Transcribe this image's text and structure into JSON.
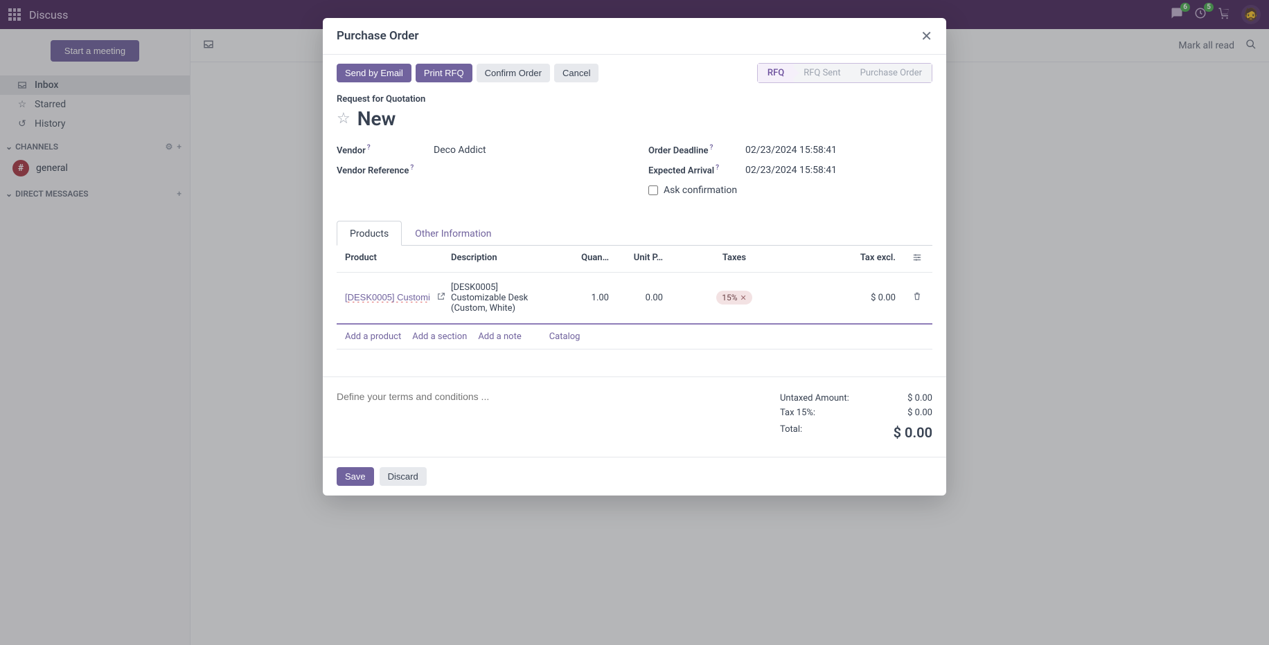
{
  "navbar": {
    "title": "Discuss",
    "chat_badge": "6",
    "activity_badge": "5"
  },
  "sidebar": {
    "start_meeting": "Start a meeting",
    "nav": {
      "inbox": "Inbox",
      "starred": "Starred",
      "history": "History"
    },
    "channels_header": "CHANNELS",
    "channel_general": "general",
    "dm_header": "DIRECT MESSAGES"
  },
  "content_header": {
    "mark_all_read": "Mark all read"
  },
  "modal": {
    "title": "Purchase Order",
    "actions": {
      "send_email": "Send by Email",
      "print_rfq": "Print RFQ",
      "confirm": "Confirm Order",
      "cancel": "Cancel"
    },
    "status": {
      "rfq": "RFQ",
      "rfq_sent": "RFQ Sent",
      "purchase_order": "Purchase Order"
    },
    "rfq_label": "Request for Quotation",
    "rfq_title": "New",
    "form": {
      "vendor_label": "Vendor",
      "vendor_value": "Deco Addict",
      "vendor_ref_label": "Vendor Reference",
      "vendor_ref_value": "",
      "deadline_label": "Order Deadline",
      "deadline_value": "02/23/2024 15:58:41",
      "arrival_label": "Expected Arrival",
      "arrival_value": "02/23/2024 15:58:41",
      "ask_confirmation": "Ask confirmation"
    },
    "tabs": {
      "products": "Products",
      "other": "Other Information"
    },
    "table": {
      "headers": {
        "product": "Product",
        "description": "Description",
        "quantity": "Quan…",
        "unit_price": "Unit P…",
        "taxes": "Taxes",
        "tax_excl": "Tax excl."
      },
      "row": {
        "product": "[DESK0005] Customi",
        "description": "[DESK0005] Customizable Desk (Custom, White)",
        "quantity": "1.00",
        "unit_price": "0.00",
        "tax": "15%",
        "tax_excl": "$ 0.00"
      },
      "links": {
        "add_product": "Add a product",
        "add_section": "Add a section",
        "add_note": "Add a note",
        "catalog": "Catalog"
      }
    },
    "terms_placeholder": "Define your terms and conditions ...",
    "totals": {
      "untaxed_label": "Untaxed Amount:",
      "untaxed_value": "$ 0.00",
      "tax15_label": "Tax 15%:",
      "tax15_value": "$ 0.00",
      "total_label": "Total:",
      "total_value": "$ 0.00"
    },
    "footer": {
      "save": "Save",
      "discard": "Discard"
    }
  }
}
